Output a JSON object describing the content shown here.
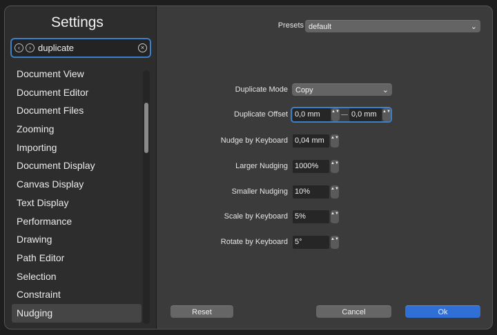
{
  "sidebar": {
    "title": "Settings",
    "search": {
      "query": "duplicate",
      "back_icon": "‹",
      "forward_icon": "›",
      "clear_icon": "×"
    },
    "items": [
      "Document View",
      "Document Editor",
      "Document Files",
      "Zooming",
      "Importing",
      "Document Display",
      "Canvas Display",
      "Text Display",
      "Performance",
      "Drawing",
      "Path Editor",
      "Selection",
      "Constraint",
      "Nudging"
    ],
    "selected": "Nudging"
  },
  "presets": {
    "label": "Presets",
    "value": "default"
  },
  "settings": {
    "duplicate_mode": {
      "label": "Duplicate Mode",
      "value": "Copy"
    },
    "duplicate_offset": {
      "label": "Duplicate Offset",
      "x": "0,0 mm",
      "y": "0,0 mm"
    },
    "nudge_by_keyboard": {
      "label": "Nudge by Keyboard",
      "value": "0,04 mm"
    },
    "larger_nudging": {
      "label": "Larger Nudging",
      "value": "1000%"
    },
    "smaller_nudging": {
      "label": "Smaller Nudging",
      "value": "10%"
    },
    "scale_by_keyboard": {
      "label": "Scale by Keyboard",
      "value": "5%"
    },
    "rotate_by_keyboard": {
      "label": "Rotate by Keyboard",
      "value": "5°"
    }
  },
  "buttons": {
    "reset": "Reset",
    "cancel": "Cancel",
    "ok": "Ok"
  },
  "icons": {
    "chevron": "⌄",
    "stepper": "▲▼"
  },
  "colors": {
    "accent": "#3d7fc9",
    "primary_button": "#2f6fd6"
  }
}
